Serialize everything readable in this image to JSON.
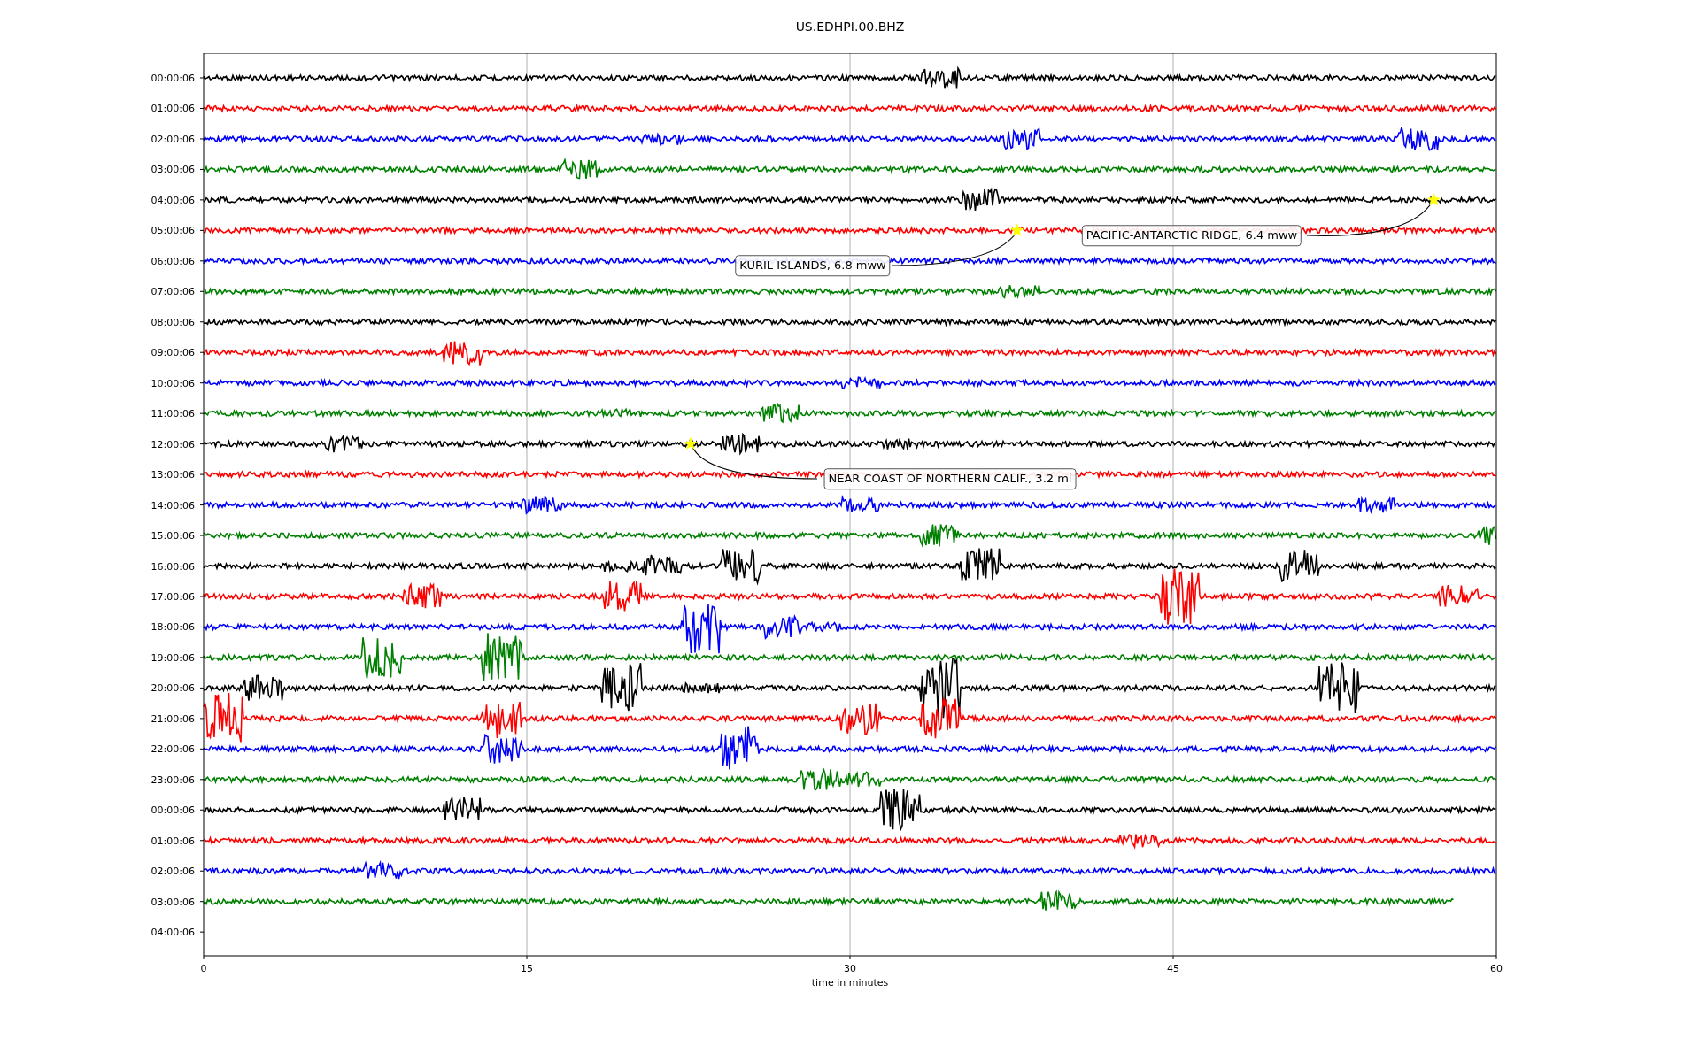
{
  "title": "US.EDHPI.00.BHZ",
  "rows": [
    {
      "label": "00:00:06",
      "color": "#000000"
    },
    {
      "label": "01:00:06",
      "color": "#ff0000"
    },
    {
      "label": "02:00:06",
      "color": "#0000ff"
    },
    {
      "label": "03:00:06",
      "color": "#008000"
    },
    {
      "label": "04:00:06",
      "color": "#000000"
    },
    {
      "label": "05:00:06",
      "color": "#ff0000"
    },
    {
      "label": "06:00:06",
      "color": "#0000ff"
    },
    {
      "label": "07:00:06",
      "color": "#008000"
    },
    {
      "label": "08:00:06",
      "color": "#000000"
    },
    {
      "label": "09:00:06",
      "color": "#ff0000"
    },
    {
      "label": "10:00:06",
      "color": "#0000ff"
    },
    {
      "label": "11:00:06",
      "color": "#008000"
    },
    {
      "label": "12:00:06",
      "color": "#000000"
    },
    {
      "label": "13:00:06",
      "color": "#ff0000"
    },
    {
      "label": "14:00:06",
      "color": "#0000ff"
    },
    {
      "label": "15:00:06",
      "color": "#008000"
    },
    {
      "label": "16:00:06",
      "color": "#000000"
    },
    {
      "label": "17:00:06",
      "color": "#ff0000"
    },
    {
      "label": "18:00:06",
      "color": "#0000ff"
    },
    {
      "label": "19:00:06",
      "color": "#008000"
    },
    {
      "label": "20:00:06",
      "color": "#000000"
    },
    {
      "label": "21:00:06",
      "color": "#ff0000"
    },
    {
      "label": "22:00:06",
      "color": "#0000ff"
    },
    {
      "label": "23:00:06",
      "color": "#008000"
    },
    {
      "label": "00:00:06",
      "color": "#000000"
    },
    {
      "label": "01:00:06",
      "color": "#ff0000"
    },
    {
      "label": "02:00:06",
      "color": "#0000ff"
    },
    {
      "label": "03:00:06",
      "color": "#008000"
    },
    {
      "label": "04:00:06"
    }
  ],
  "x_ticks": [
    "0",
    "15",
    "30",
    "45",
    "60"
  ],
  "xlabel": "time in minutes",
  "events": [
    {
      "text": "KURIL ISLANDS, 6.8 mww"
    },
    {
      "text": "PACIFIC-ANTARCTIC RIDGE, 6.4 mww"
    },
    {
      "text": "NEAR COAST OF NORTHERN CALIF., 3.2 ml"
    }
  ]
}
